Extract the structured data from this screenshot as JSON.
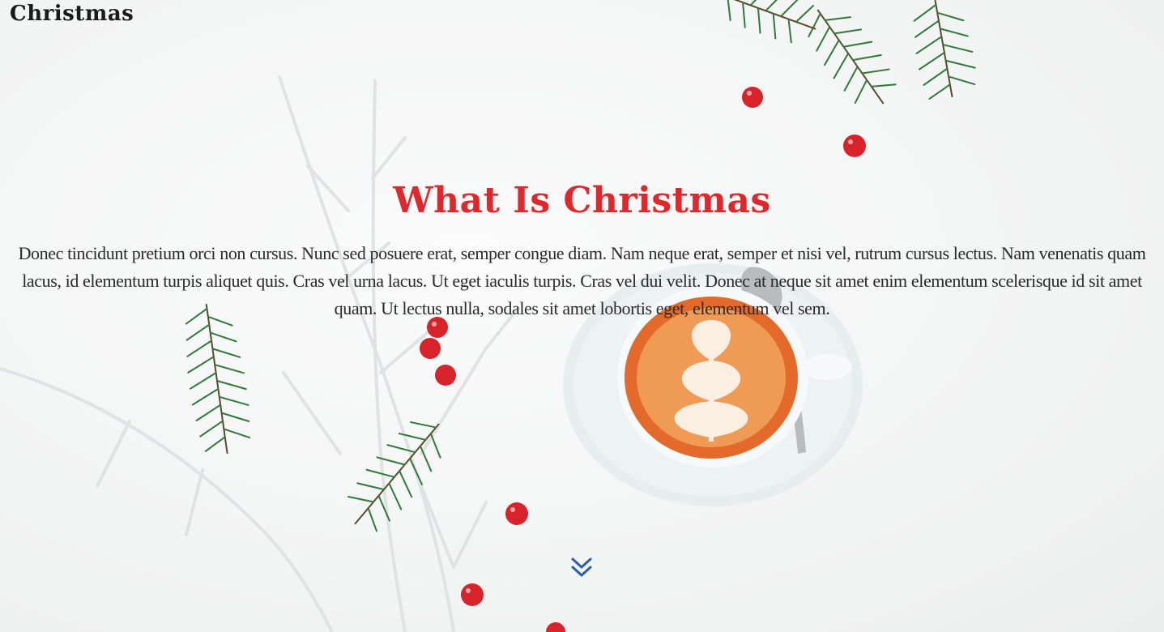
{
  "site": {
    "logo_text": "Christmas"
  },
  "hero": {
    "title": "What Is Christmas",
    "body": "Donec tincidunt pretium orci non cursus. Nunc sed posuere erat, semper congue diam. Nam neque erat, semper et nisi vel, rutrum cursus lectus. Nam venenatis quam lacus, id elementum turpis aliquet quis. Cras vel urna lacus. Ut eget iaculis turpis. Cras vel dui velit. Donec at neque sit amet enim elementum scelerisque id sit amet quam. Ut lectus nulla, sodales sit amet lobortis eget, elementum vel sem.",
    "scroll_icon": "double-chevron-down-icon"
  },
  "colors": {
    "title": "#e0272b",
    "text": "#2a2a2a",
    "scroll_icon": "#2c5fa8",
    "berry": "#d8232a",
    "pine": "#2e7d3a"
  }
}
